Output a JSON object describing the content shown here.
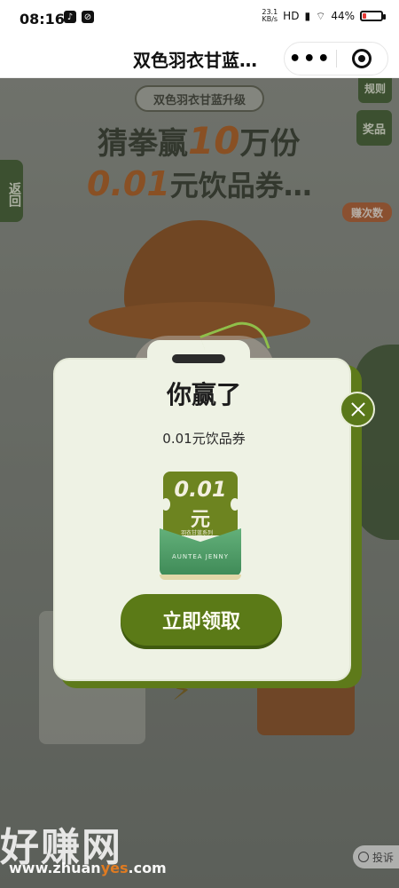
{
  "status_bar": {
    "time": "08:16",
    "net_speed": "23.1\nKB/s",
    "network_label": "HD",
    "battery_percent": "44%",
    "battery_fill_percent": 18
  },
  "header": {
    "title": "双色羽衣甘蓝…",
    "more_label": "•••"
  },
  "background": {
    "badge": "双色羽衣甘蓝升级",
    "headline_prefix": "猜拳赢",
    "headline_big": "10",
    "headline_suffix": "万份",
    "sub_price": "0.01",
    "sub_suffix": "元饮品券…",
    "back_label": "返回",
    "rules_label": "规则",
    "prize_label": "奖品",
    "earn_label": "赚次数"
  },
  "popup": {
    "title": "你赢了",
    "subtitle": "0.01元饮品券",
    "voucher": {
      "price": "0.01",
      "unit": "元",
      "series": "羽衣甘蓝系列",
      "brand": "AUNTEA JENNY"
    },
    "claim_button": "立即领取"
  },
  "watermark": {
    "text": "好赚网",
    "url_prefix": "www.zhuan",
    "url_highlight": "yes",
    "url_suffix": ".com"
  },
  "report_label": "投诉"
}
